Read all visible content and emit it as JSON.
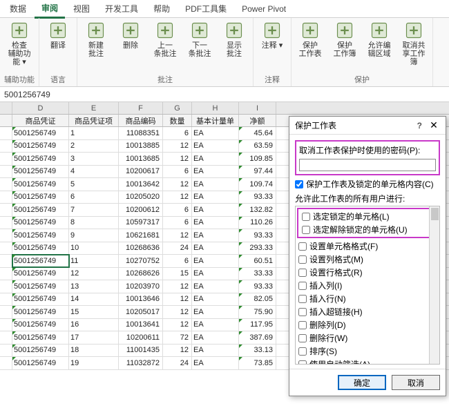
{
  "tabs": [
    "数据",
    "审阅",
    "视图",
    "开发工具",
    "帮助",
    "PDF工具集",
    "Power Pivot"
  ],
  "active_tab": 1,
  "ribbon_groups": [
    {
      "label": "辅助功能",
      "items": [
        {
          "t": "检查\n辅助功能 ▾"
        }
      ]
    },
    {
      "label": "语言",
      "items": [
        {
          "t": "翻译"
        }
      ]
    },
    {
      "label": "批注",
      "items": [
        {
          "t": "新建\n批注"
        },
        {
          "t": "删除"
        },
        {
          "t": "上一\n条批注"
        },
        {
          "t": "下一\n条批注"
        },
        {
          "t": "显示\n批注"
        }
      ]
    },
    {
      "label": "注释",
      "items": [
        {
          "t": "注释 ▾"
        }
      ]
    },
    {
      "label": "保护",
      "items": [
        {
          "t": "保护\n工作表"
        },
        {
          "t": "保护\n工作簿"
        },
        {
          "t": "允许编\n辑区域"
        },
        {
          "t": "取消共\n享工作簿"
        }
      ]
    }
  ],
  "formula_value": "5001256749",
  "col_letters": [
    "",
    "D",
    "E",
    "F",
    "G",
    "H",
    "I"
  ],
  "headers": [
    "",
    "商品凭证",
    "商品凭证项",
    "商品编码",
    "数量",
    "基本计量单",
    "净额"
  ],
  "rows": [
    [
      "5001256749",
      "1",
      "11088351",
      "6",
      "EA",
      "45.64"
    ],
    [
      "5001256749",
      "2",
      "10013885",
      "12",
      "EA",
      "63.59"
    ],
    [
      "5001256749",
      "3",
      "10013685",
      "12",
      "EA",
      "109.85"
    ],
    [
      "5001256749",
      "4",
      "10200617",
      "6",
      "EA",
      "97.44"
    ],
    [
      "5001256749",
      "5",
      "10013642",
      "12",
      "EA",
      "109.74"
    ],
    [
      "5001256749",
      "6",
      "10205020",
      "12",
      "EA",
      "93.33"
    ],
    [
      "5001256749",
      "7",
      "10200612",
      "6",
      "EA",
      "132.82"
    ],
    [
      "5001256749",
      "8",
      "10597317",
      "6",
      "EA",
      "110.26"
    ],
    [
      "5001256749",
      "9",
      "10621681",
      "12",
      "EA",
      "93.33"
    ],
    [
      "5001256749",
      "10",
      "10268636",
      "24",
      "EA",
      "293.33"
    ],
    [
      "5001256749",
      "11",
      "10270752",
      "6",
      "EA",
      "60.51"
    ],
    [
      "5001256749",
      "12",
      "10268626",
      "15",
      "EA",
      "33.33"
    ],
    [
      "5001256749",
      "13",
      "10203970",
      "12",
      "EA",
      "93.33"
    ],
    [
      "5001256749",
      "14",
      "10013646",
      "12",
      "EA",
      "82.05"
    ],
    [
      "5001256749",
      "15",
      "10205017",
      "12",
      "EA",
      "75.90"
    ],
    [
      "5001256749",
      "16",
      "10013641",
      "12",
      "EA",
      "117.95"
    ],
    [
      "5001256749",
      "17",
      "10200611",
      "72",
      "EA",
      "387.69"
    ],
    [
      "5001256749",
      "18",
      "11001435",
      "12",
      "EA",
      "33.13"
    ],
    [
      "5001256749",
      "19",
      "11032872",
      "24",
      "EA",
      "73.85"
    ]
  ],
  "selected_row": 10,
  "dialog": {
    "title": "保护工作表",
    "pw_label": "取消工作表保护时使用的密码(P):",
    "content_chk": "保护工作表及锁定的单元格内容(C)",
    "perm_label": "允许此工作表的所有用户进行:",
    "perms": [
      "选定锁定的单元格(L)",
      "选定解除锁定的单元格(U)",
      "设置单元格格式(F)",
      "设置列格式(M)",
      "设置行格式(R)",
      "插入列(I)",
      "插入行(N)",
      "插入超链接(H)",
      "删除列(D)",
      "删除行(W)",
      "排序(S)",
      "使用自动筛选(A)"
    ],
    "ok": "确定",
    "cancel": "取消"
  }
}
